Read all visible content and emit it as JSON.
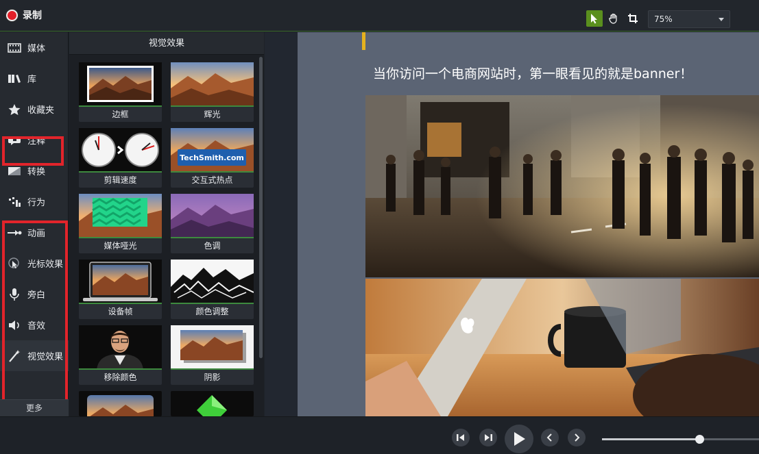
{
  "topbar": {
    "record_label": "录制",
    "zoom": "75%"
  },
  "sidebar": {
    "items": [
      {
        "label": "媒体",
        "icon": "film-icon"
      },
      {
        "label": "库",
        "icon": "library-icon"
      },
      {
        "label": "收藏夹",
        "icon": "star-icon"
      },
      {
        "label": "注释",
        "icon": "annotation-icon"
      },
      {
        "label": "转换",
        "icon": "transition-icon"
      },
      {
        "label": "行为",
        "icon": "behavior-icon"
      },
      {
        "label": "动画",
        "icon": "animation-icon"
      },
      {
        "label": "光标效果",
        "icon": "cursor-effect-icon"
      },
      {
        "label": "旁白",
        "icon": "microphone-icon"
      },
      {
        "label": "音效",
        "icon": "speaker-icon"
      },
      {
        "label": "视觉效果",
        "icon": "magic-wand-icon"
      }
    ],
    "more_label": "更多",
    "highlight_color": "#e2242b"
  },
  "panel": {
    "title": "视觉效果",
    "effects": [
      {
        "label": "边框"
      },
      {
        "label": "辉光"
      },
      {
        "label": "剪辑速度"
      },
      {
        "label": "交互式热点",
        "thumb_text": "TechSmith.com"
      },
      {
        "label": "媒体哑光"
      },
      {
        "label": "色调"
      },
      {
        "label": "设备帧"
      },
      {
        "label": "颜色调整"
      },
      {
        "label": "移除颜色"
      },
      {
        "label": "阴影"
      },
      {
        "label": ""
      },
      {
        "label": ""
      }
    ]
  },
  "canvas": {
    "headline": "当你访问一个电商网站时，第一眼看见的就是banner！"
  },
  "playback": {
    "position": 0.62
  }
}
